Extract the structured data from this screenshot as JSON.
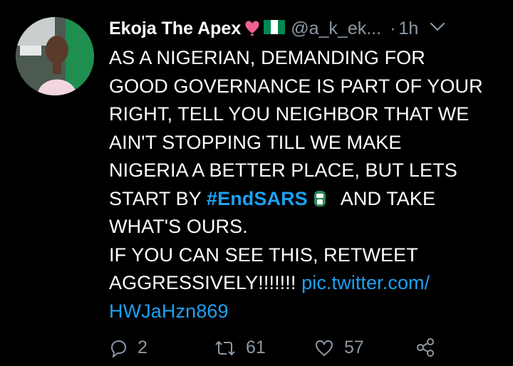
{
  "tweet": {
    "display_name": "Ekoja The Apex",
    "handle": "@a_k_ek...",
    "separator": "·",
    "time": "1h",
    "body": {
      "line1": "AS A NIGERIAN, DEMANDING FOR",
      "line2": "GOOD GOVERNANCE IS PART OF YOUR",
      "line3": "RIGHT, TELL YOU NEIGHBOR THAT WE",
      "line4": "AIN'T STOPPING TILL WE MAKE",
      "line5": "NIGERIA A BETTER PLACE, BUT LETS",
      "line6_prefix": "START BY",
      "hashtag": "#EndSARS",
      "line6_suffix": "AND TAKE",
      "line7": "WHAT'S OURS.",
      "line8": "IF YOU CAN SEE THIS, RETWEET",
      "line9_prefix": "AGGRESSIVELY!!!!!!!",
      "link_part1": "pic.twitter.com/",
      "link_part2": "HWJaHzn869"
    },
    "actions": {
      "reply_count": "2",
      "retweet_count": "61",
      "like_count": "57"
    },
    "colors": {
      "link": "#1da1f2",
      "secondary": "#8b98a5",
      "background": "#000000",
      "heart_emoji": "#f06292",
      "flag_green": "#008751"
    },
    "icons": [
      "heart-emoji",
      "nigeria-flag-emoji",
      "chevron-down-icon",
      "green-fist-emoji",
      "reply-icon",
      "retweet-icon",
      "like-icon",
      "share-icon"
    ]
  }
}
